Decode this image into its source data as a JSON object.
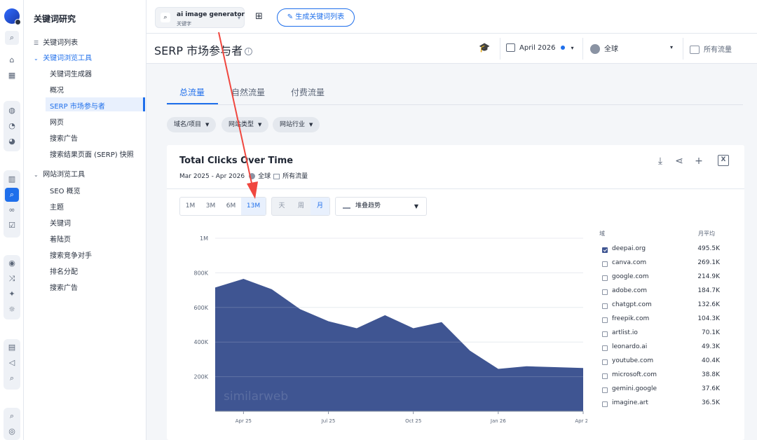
{
  "sidebar_nav": {
    "title": "关键词研究",
    "items": [
      {
        "label": "关键词列表",
        "top": 52
      },
      {
        "label": "关键词浏览工具",
        "top": 74
      },
      {
        "label": "关键词生成器",
        "top": 97
      },
      {
        "label": "概况",
        "top": 120
      },
      {
        "label": "SERP 市场参与者",
        "top": 143
      },
      {
        "label": "网页",
        "top": 166
      },
      {
        "label": "搜索广告",
        "top": 189
      },
      {
        "label": "搜索结果页面 (SERP) 快照",
        "top": 212
      },
      {
        "label": "网站浏览工具",
        "top": 240
      },
      {
        "label": "SEO 概览",
        "top": 264
      },
      {
        "label": "主题",
        "top": 287
      },
      {
        "label": "关键词",
        "top": 310
      },
      {
        "label": "着陆页",
        "top": 333
      },
      {
        "label": "搜索竞争对手",
        "top": 356
      },
      {
        "label": "排名分配",
        "top": 379
      },
      {
        "label": "搜索广告",
        "top": 402
      }
    ]
  },
  "topbar": {
    "search_keyword": "ai image generator",
    "search_sub": "关键字",
    "generate_btn": "生成关键词列表"
  },
  "header": {
    "title": "SERP 市场参与者",
    "date": "April 2026",
    "country": "全球",
    "traffic": "所有流量"
  },
  "tabs": [
    "总流量",
    "自然流量",
    "付费流量"
  ],
  "filters": [
    "域名/项目",
    "网站类型",
    "网站行业"
  ],
  "card": {
    "title": "Total Clicks Over Time",
    "range": "Mar 2025 - Apr 2026",
    "country": "全球",
    "traffic": "所有流量",
    "period_buttons": [
      "1M",
      "3M",
      "6M",
      "13M"
    ],
    "granularity_buttons": [
      "天",
      "周",
      "月"
    ],
    "chart_style": "堆叠趋势",
    "legend_header_domain": "域",
    "legend_header_avg": "月平均",
    "watermark": "similarweb"
  },
  "legend": [
    {
      "domain": "deepai.org",
      "value": "495.5K",
      "checked": true
    },
    {
      "domain": "canva.com",
      "value": "269.1K",
      "checked": false
    },
    {
      "domain": "google.com",
      "value": "214.9K",
      "checked": false
    },
    {
      "domain": "adobe.com",
      "value": "184.7K",
      "checked": false
    },
    {
      "domain": "chatgpt.com",
      "value": "132.6K",
      "checked": false
    },
    {
      "domain": "freepik.com",
      "value": "104.3K",
      "checked": false
    },
    {
      "domain": "artlist.io",
      "value": "70.1K",
      "checked": false
    },
    {
      "domain": "leonardo.ai",
      "value": "49.3K",
      "checked": false
    },
    {
      "domain": "youtube.com",
      "value": "40.4K",
      "checked": false
    },
    {
      "domain": "microsoft.com",
      "value": "38.8K",
      "checked": false
    },
    {
      "domain": "gemini.google",
      "value": "37.6K",
      "checked": false
    },
    {
      "domain": "imagine.art",
      "value": "36.5K",
      "checked": false
    }
  ],
  "chart_data": {
    "type": "area",
    "title": "Total Clicks Over Time",
    "x": [
      "2025-03",
      "2025-04",
      "2025-05",
      "2025-06",
      "2025-07",
      "2025-08",
      "2025-09",
      "2025-10",
      "2025-11",
      "2025-12",
      "2026-01",
      "2026-02",
      "2026-03",
      "2026-04"
    ],
    "x_tick_labels": [
      "Apr 25",
      "Jul 25",
      "Oct 25",
      "Jan 26",
      "Apr 26"
    ],
    "y_tick_labels": [
      "200K",
      "400K",
      "600K",
      "800K",
      "1M"
    ],
    "series": [
      {
        "name": "deepai.org",
        "color": "#3f5592",
        "values": [
          715000,
          765000,
          705000,
          590000,
          520000,
          480000,
          555000,
          480000,
          515000,
          350000,
          245000,
          260000,
          255000,
          250000
        ]
      }
    ],
    "ylim": [
      0,
      1000000
    ]
  }
}
